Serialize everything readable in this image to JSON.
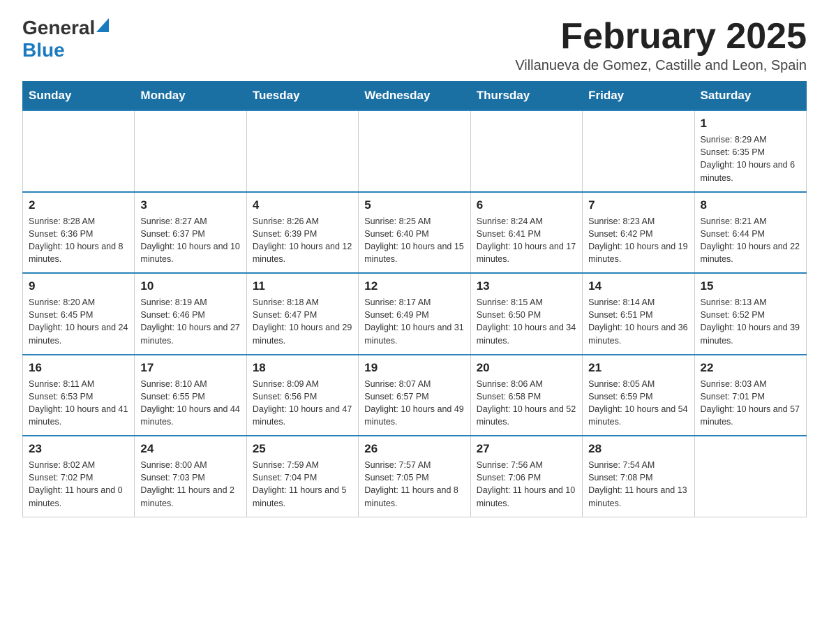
{
  "header": {
    "logo_general": "General",
    "logo_blue": "Blue",
    "month_title": "February 2025",
    "location": "Villanueva de Gomez, Castille and Leon, Spain"
  },
  "days_of_week": [
    "Sunday",
    "Monday",
    "Tuesday",
    "Wednesday",
    "Thursday",
    "Friday",
    "Saturday"
  ],
  "weeks": [
    [
      {
        "day": "",
        "info": ""
      },
      {
        "day": "",
        "info": ""
      },
      {
        "day": "",
        "info": ""
      },
      {
        "day": "",
        "info": ""
      },
      {
        "day": "",
        "info": ""
      },
      {
        "day": "",
        "info": ""
      },
      {
        "day": "1",
        "info": "Sunrise: 8:29 AM\nSunset: 6:35 PM\nDaylight: 10 hours and 6 minutes."
      }
    ],
    [
      {
        "day": "2",
        "info": "Sunrise: 8:28 AM\nSunset: 6:36 PM\nDaylight: 10 hours and 8 minutes."
      },
      {
        "day": "3",
        "info": "Sunrise: 8:27 AM\nSunset: 6:37 PM\nDaylight: 10 hours and 10 minutes."
      },
      {
        "day": "4",
        "info": "Sunrise: 8:26 AM\nSunset: 6:39 PM\nDaylight: 10 hours and 12 minutes."
      },
      {
        "day": "5",
        "info": "Sunrise: 8:25 AM\nSunset: 6:40 PM\nDaylight: 10 hours and 15 minutes."
      },
      {
        "day": "6",
        "info": "Sunrise: 8:24 AM\nSunset: 6:41 PM\nDaylight: 10 hours and 17 minutes."
      },
      {
        "day": "7",
        "info": "Sunrise: 8:23 AM\nSunset: 6:42 PM\nDaylight: 10 hours and 19 minutes."
      },
      {
        "day": "8",
        "info": "Sunrise: 8:21 AM\nSunset: 6:44 PM\nDaylight: 10 hours and 22 minutes."
      }
    ],
    [
      {
        "day": "9",
        "info": "Sunrise: 8:20 AM\nSunset: 6:45 PM\nDaylight: 10 hours and 24 minutes."
      },
      {
        "day": "10",
        "info": "Sunrise: 8:19 AM\nSunset: 6:46 PM\nDaylight: 10 hours and 27 minutes."
      },
      {
        "day": "11",
        "info": "Sunrise: 8:18 AM\nSunset: 6:47 PM\nDaylight: 10 hours and 29 minutes."
      },
      {
        "day": "12",
        "info": "Sunrise: 8:17 AM\nSunset: 6:49 PM\nDaylight: 10 hours and 31 minutes."
      },
      {
        "day": "13",
        "info": "Sunrise: 8:15 AM\nSunset: 6:50 PM\nDaylight: 10 hours and 34 minutes."
      },
      {
        "day": "14",
        "info": "Sunrise: 8:14 AM\nSunset: 6:51 PM\nDaylight: 10 hours and 36 minutes."
      },
      {
        "day": "15",
        "info": "Sunrise: 8:13 AM\nSunset: 6:52 PM\nDaylight: 10 hours and 39 minutes."
      }
    ],
    [
      {
        "day": "16",
        "info": "Sunrise: 8:11 AM\nSunset: 6:53 PM\nDaylight: 10 hours and 41 minutes."
      },
      {
        "day": "17",
        "info": "Sunrise: 8:10 AM\nSunset: 6:55 PM\nDaylight: 10 hours and 44 minutes."
      },
      {
        "day": "18",
        "info": "Sunrise: 8:09 AM\nSunset: 6:56 PM\nDaylight: 10 hours and 47 minutes."
      },
      {
        "day": "19",
        "info": "Sunrise: 8:07 AM\nSunset: 6:57 PM\nDaylight: 10 hours and 49 minutes."
      },
      {
        "day": "20",
        "info": "Sunrise: 8:06 AM\nSunset: 6:58 PM\nDaylight: 10 hours and 52 minutes."
      },
      {
        "day": "21",
        "info": "Sunrise: 8:05 AM\nSunset: 6:59 PM\nDaylight: 10 hours and 54 minutes."
      },
      {
        "day": "22",
        "info": "Sunrise: 8:03 AM\nSunset: 7:01 PM\nDaylight: 10 hours and 57 minutes."
      }
    ],
    [
      {
        "day": "23",
        "info": "Sunrise: 8:02 AM\nSunset: 7:02 PM\nDaylight: 11 hours and 0 minutes."
      },
      {
        "day": "24",
        "info": "Sunrise: 8:00 AM\nSunset: 7:03 PM\nDaylight: 11 hours and 2 minutes."
      },
      {
        "day": "25",
        "info": "Sunrise: 7:59 AM\nSunset: 7:04 PM\nDaylight: 11 hours and 5 minutes."
      },
      {
        "day": "26",
        "info": "Sunrise: 7:57 AM\nSunset: 7:05 PM\nDaylight: 11 hours and 8 minutes."
      },
      {
        "day": "27",
        "info": "Sunrise: 7:56 AM\nSunset: 7:06 PM\nDaylight: 11 hours and 10 minutes."
      },
      {
        "day": "28",
        "info": "Sunrise: 7:54 AM\nSunset: 7:08 PM\nDaylight: 11 hours and 13 minutes."
      },
      {
        "day": "",
        "info": ""
      }
    ]
  ]
}
